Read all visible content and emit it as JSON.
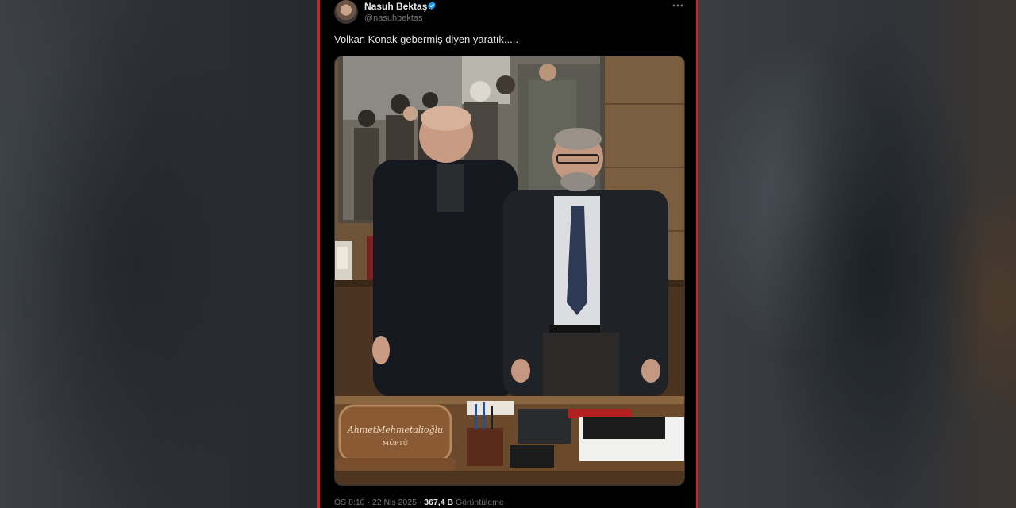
{
  "tweet": {
    "display_name": "Nasuh Bektaş",
    "handle": "@nasuhbektas",
    "text": "Volkan Konak gebermiş diyen yaratık.....",
    "time": "ÖS 8:10",
    "separator": "·",
    "date": "22 Nis 2025",
    "views_count": "367,4 B",
    "views_label": "Görüntüleme",
    "accent_color": "#1d9bf0",
    "frame_color": "#e21b1b",
    "icons": [
      "verified-badge-icon",
      "more-options-icon"
    ]
  },
  "photo": {
    "nameplate_line1": "AhmetMehmetalioğlu",
    "nameplate_line2": "MÜFTÜ"
  }
}
